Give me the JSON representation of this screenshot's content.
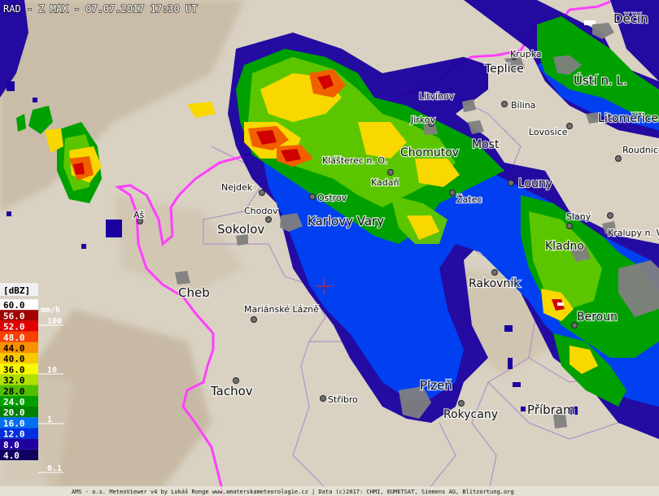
{
  "header": {
    "title": "RAD - Z MAX - 07.07.2017 17:30 UT"
  },
  "credit": "AMS - o.s. MeteoViewer v4 by Lukáš Ronge www.amaterskameteorologie.cz | Data (c)2017: CHMI, EUMETSAT, Siemens AG, Blitzortung.org",
  "legend": {
    "unit_dbz": "[dBZ]",
    "unit_rain": "mm/h",
    "levels": [
      {
        "dbz": "60.0",
        "color": "#ffffff",
        "text": "#000000"
      },
      {
        "dbz": "56.0",
        "color": "#a00000",
        "text": "#ffffff"
      },
      {
        "dbz": "52.0",
        "color": "#e00000",
        "text": "#ffffff"
      },
      {
        "dbz": "48.0",
        "color": "#f84000",
        "text": "#ffffff"
      },
      {
        "dbz": "44.0",
        "color": "#f89000",
        "text": "#000000"
      },
      {
        "dbz": "40.0",
        "color": "#f8c800",
        "text": "#000000"
      },
      {
        "dbz": "36.0",
        "color": "#f8f800",
        "text": "#000000"
      },
      {
        "dbz": "32.0",
        "color": "#b0e000",
        "text": "#000000"
      },
      {
        "dbz": "28.0",
        "color": "#50c000",
        "text": "#000000"
      },
      {
        "dbz": "24.0",
        "color": "#00a000",
        "text": "#ffffff"
      },
      {
        "dbz": "20.0",
        "color": "#008000",
        "text": "#ffffff"
      },
      {
        "dbz": "16.0",
        "color": "#0070f0",
        "text": "#ffffff"
      },
      {
        "dbz": "12.0",
        "color": "#0030e0",
        "text": "#ffffff"
      },
      {
        "dbz": "8.0",
        "color": "#2000a0",
        "text": "#ffffff"
      },
      {
        "dbz": "4.0",
        "color": "#100060",
        "text": "#ffffff"
      }
    ],
    "rain_marks": [
      "100",
      "10",
      "1",
      "0.1"
    ]
  },
  "colors": {
    "border_line": "#ff40ff",
    "region_line": "#a080c0",
    "terrain": "#d8d0c0",
    "radar_blue": "#0030e0",
    "radar_green": "#00a000",
    "radar_yellow": "#f8e000",
    "radar_red": "#e00000"
  },
  "places": [
    {
      "name": "Děčín",
      "size": "lg"
    },
    {
      "name": "Krupka",
      "size": "sm"
    },
    {
      "name": "Teplice",
      "size": "md"
    },
    {
      "name": "Ústí n. L.",
      "size": "lg"
    },
    {
      "name": "Litvínov",
      "size": "sm"
    },
    {
      "name": "Bílina",
      "size": "sm"
    },
    {
      "name": "Lovosice",
      "size": "sm"
    },
    {
      "name": "Litoměřice",
      "size": "md"
    },
    {
      "name": "Jirkov",
      "size": "sm"
    },
    {
      "name": "Chomutov",
      "size": "md"
    },
    {
      "name": "Most",
      "size": "md"
    },
    {
      "name": "Roudnice",
      "size": "sm"
    },
    {
      "name": "Klášterec n. O.",
      "size": "sm"
    },
    {
      "name": "Kadaň",
      "size": "sm"
    },
    {
      "name": "Nejdek",
      "size": "sm"
    },
    {
      "name": "Ostrov",
      "size": "sm"
    },
    {
      "name": "Žatec",
      "size": "sm"
    },
    {
      "name": "Louny",
      "size": "md"
    },
    {
      "name": "Aš",
      "size": "sm"
    },
    {
      "name": "Chodov",
      "size": "sm"
    },
    {
      "name": "Sokolov",
      "size": "lg"
    },
    {
      "name": "Karlovy Vary",
      "size": "lg"
    },
    {
      "name": "Slaný",
      "size": "sm"
    },
    {
      "name": "Kralupy n. V.",
      "size": "sm"
    },
    {
      "name": "Kladno",
      "size": "md"
    },
    {
      "name": "Cheb",
      "size": "lg"
    },
    {
      "name": "Rakovník",
      "size": "md"
    },
    {
      "name": "Mariánské Lázně",
      "size": "sm"
    },
    {
      "name": "Beroun",
      "size": "md"
    },
    {
      "name": "Tachov",
      "size": "lg"
    },
    {
      "name": "Stříbro",
      "size": "sm"
    },
    {
      "name": "Plzeň",
      "size": "lg"
    },
    {
      "name": "Rokycany",
      "size": "md"
    },
    {
      "name": "Příbram",
      "size": "lg"
    }
  ]
}
